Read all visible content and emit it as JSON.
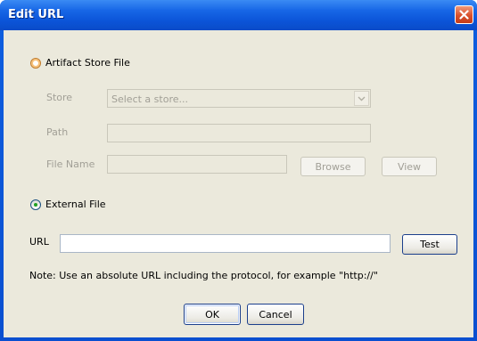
{
  "window": {
    "title": "Edit URL"
  },
  "artifact": {
    "option_label": "Artifact Store File",
    "store_label": "Store",
    "store_placeholder": "Select a store...",
    "path_label": "Path",
    "path_value": "",
    "filename_label": "File Name",
    "filename_value": "",
    "browse_label": "Browse",
    "view_label": "View"
  },
  "external": {
    "option_label": "External File",
    "url_label": "URL",
    "url_value": "",
    "test_label": "Test"
  },
  "note": "Note: Use an absolute URL including the protocol, for example \"http://\"",
  "buttons": {
    "ok": "OK",
    "cancel": "Cancel"
  },
  "selection": "External File",
  "icons": [
    "close-icon",
    "chevron-down-icon"
  ],
  "colors": {
    "titlebar": "#0b54d8",
    "client_bg": "#ebe9dc",
    "close": "#d9502c"
  }
}
